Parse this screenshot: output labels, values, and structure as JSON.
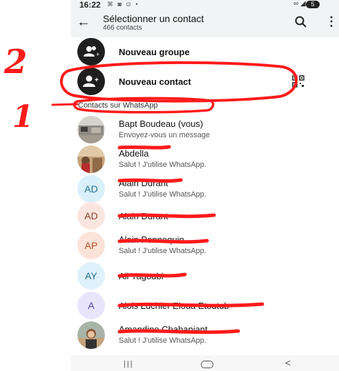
{
  "status": {
    "time": "16:22",
    "left_icons": "⌘ ◙ ⊙ •",
    "right_icons": "∞ ◢ ▮",
    "battery": "5"
  },
  "header": {
    "title": "Sélectionner un contact",
    "subtitle": "466 contacts"
  },
  "actions": [
    {
      "label": "Nouveau groupe",
      "icon": "group-add-icon"
    },
    {
      "label": "Nouveau contact",
      "icon": "person-add-icon"
    }
  ],
  "section": "Contacts sur WhatsApp",
  "contacts": [
    {
      "name": "Bapt Boudeau (vous)",
      "status": "Envoyez-vous un message"
    },
    {
      "name": "Abdella",
      "status": "Salut ! J'utilise WhatsApp."
    },
    {
      "name": "Alain Durant",
      "initials": "AD",
      "status": "Salut ! J'utilise WhatsApp."
    },
    {
      "name": "Alain Durant",
      "initials": "AD",
      "status": ""
    },
    {
      "name": "Alain Pennequin",
      "initials": "AP",
      "status": "Salut ! J'utilise WhatsApp."
    },
    {
      "name": "Ali Yagoubi",
      "initials": "AY",
      "status": ""
    },
    {
      "name": "Alois Luchier Eloua Etoutub",
      "initials": "A",
      "status": ""
    },
    {
      "name": "Amandine Chabaniant",
      "status": "Salut ! J'utilise WhatsApp."
    }
  ],
  "annotations": {
    "one": "1",
    "two": "2"
  },
  "colors": {
    "header_bg": "#f1f3f4",
    "annotation_red": "#ff1a1a",
    "avatar_ad": "#d9f0fb",
    "avatar_ad2": "#fbe6df",
    "avatar_ap": "#fbe3da",
    "avatar_ay": "#dff1fb",
    "avatar_a": "#e8e5fb"
  }
}
